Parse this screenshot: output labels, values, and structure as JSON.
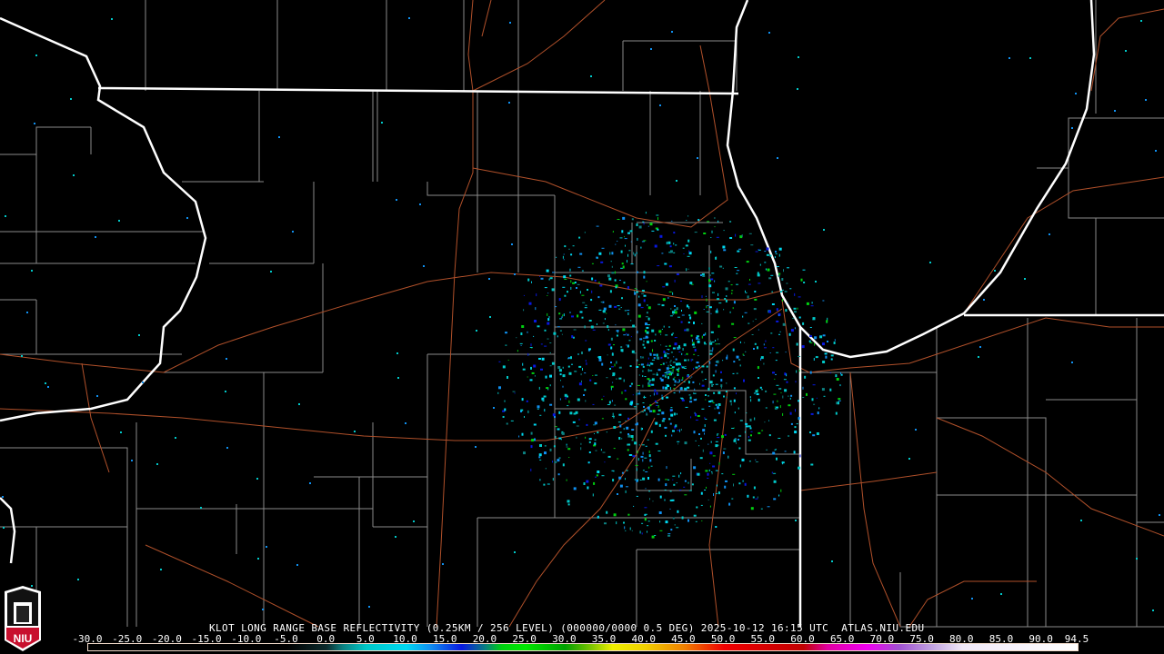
{
  "product_title": "KLOT LONG RANGE BASE REFLECTIVITY (0.25KM / 256 LEVEL) (000000/0000 0.5 DEG) 2025-10-12 16:15 UTC  ATLAS.NIU.EDU",
  "logo": {
    "text": "NIU",
    "icon": "niu-shield-logo"
  },
  "colorbar": {
    "range": [
      -30.0,
      94.5
    ],
    "tick_labels": [
      "-30.0",
      "-25.0",
      "-20.0",
      "-15.0",
      "-10.0",
      "-5.0",
      "0.0",
      "5.0",
      "10.0",
      "15.0",
      "20.0",
      "25.0",
      "30.0",
      "35.0",
      "40.0",
      "45.0",
      "50.0",
      "55.0",
      "60.0",
      "65.0",
      "70.0",
      "75.0",
      "80.0",
      "85.0",
      "90.0",
      "94.5"
    ],
    "tick_values": [
      -30,
      -25,
      -20,
      -15,
      -10,
      -5,
      0,
      5,
      10,
      15,
      20,
      25,
      30,
      35,
      40,
      45,
      50,
      55,
      60,
      65,
      70,
      75,
      80,
      85,
      90,
      94.5
    ],
    "stops": [
      {
        "v": -30,
        "c": "#000000"
      },
      {
        "v": -5,
        "c": "#000000"
      },
      {
        "v": 0,
        "c": "#0b2a2c"
      },
      {
        "v": 2,
        "c": "#0c8080"
      },
      {
        "v": 5,
        "c": "#00c8c8"
      },
      {
        "v": 10,
        "c": "#00d8f0"
      },
      {
        "v": 13,
        "c": "#1090f0"
      },
      {
        "v": 17,
        "c": "#0818e0"
      },
      {
        "v": 20,
        "c": "#088080"
      },
      {
        "v": 22,
        "c": "#00d010"
      },
      {
        "v": 25,
        "c": "#00e800"
      },
      {
        "v": 30,
        "c": "#00a000"
      },
      {
        "v": 33,
        "c": "#70c000"
      },
      {
        "v": 36,
        "c": "#f0f000"
      },
      {
        "v": 40,
        "c": "#f0d000"
      },
      {
        "v": 45,
        "c": "#f08000"
      },
      {
        "v": 50,
        "c": "#f00000"
      },
      {
        "v": 60,
        "c": "#c00000"
      },
      {
        "v": 63,
        "c": "#e000a0"
      },
      {
        "v": 68,
        "c": "#f000f0"
      },
      {
        "v": 72,
        "c": "#a050d0"
      },
      {
        "v": 76,
        "c": "#c0a0e0"
      },
      {
        "v": 80,
        "c": "#f0e8f8"
      },
      {
        "v": 94.5,
        "c": "#ffffff"
      }
    ]
  },
  "colors": {
    "state_border": "#ffffff",
    "county_border": "#8a8a8a",
    "highway": "#b0502a",
    "background": "#000000"
  }
}
